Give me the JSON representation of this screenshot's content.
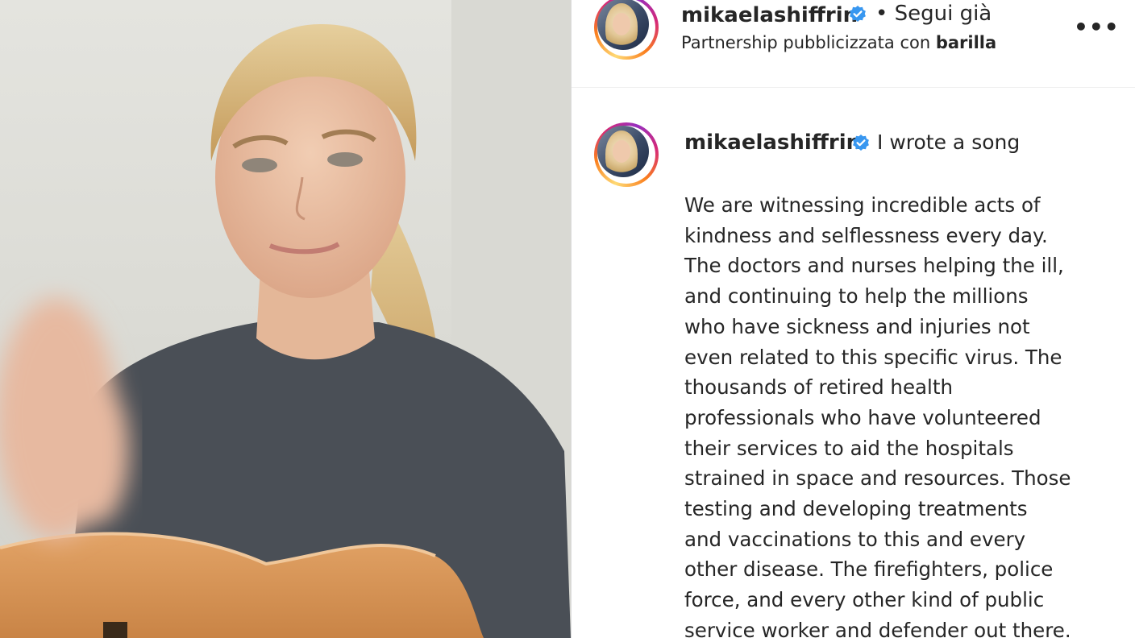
{
  "post": {
    "media": {
      "alt_icon": "video-frame"
    },
    "header": {
      "username": "mikaelashiffrin",
      "verified_icon": "verified-badge-icon",
      "follow_status": "• Segui già",
      "partnership_prefix": "Partnership pubblicizzata con",
      "partner_name": "barilla",
      "more_icon": "more-options-icon",
      "more_glyph": "•••"
    },
    "caption": {
      "username": "mikaelashiffrin",
      "title": "I wrote a song",
      "lines": [
        "We are witnessing incredible acts of",
        "kindness and selflessness every day.",
        "The doctors and nurses helping the ill,",
        "and continuing to help the millions",
        "who have sickness and injuries not",
        "even related to this specific virus. The",
        "thousands of retired health",
        "professionals who have volunteered",
        "their services to aid the hospitals",
        "strained in space and resources. Those",
        "testing and developing treatments",
        "and vaccinations to this and every",
        "other disease. The firefighters, police",
        "force, and every other kind of public",
        "service worker and defender out there."
      ]
    },
    "colors": {
      "verified": "#3897f0",
      "text": "#262626",
      "ring_start": "#feda75",
      "ring_end": "#962fbf"
    }
  }
}
